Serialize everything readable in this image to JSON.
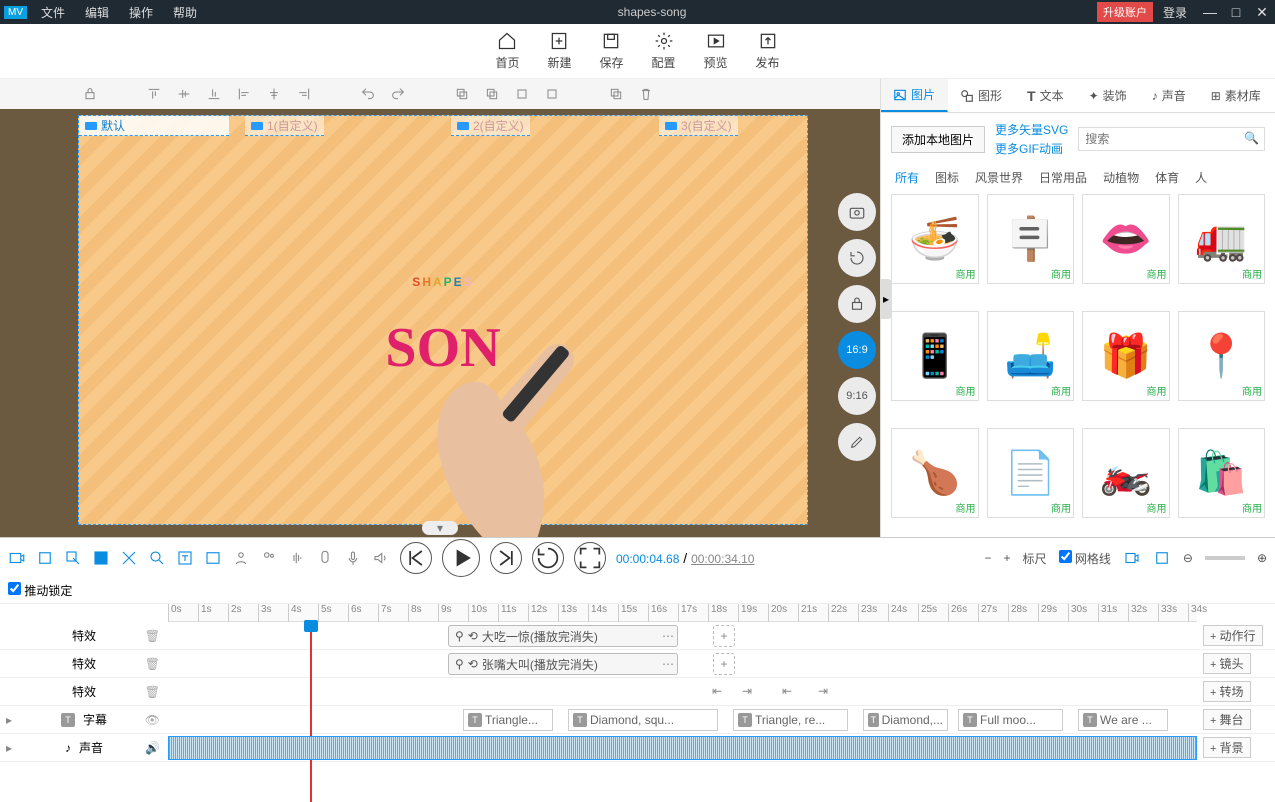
{
  "titlebar": {
    "menus": [
      "文件",
      "编辑",
      "操作",
      "帮助"
    ],
    "title": "shapes-song",
    "upgrade": "升级账户",
    "login": "登录"
  },
  "toolbar": [
    {
      "id": "home",
      "label": "首页"
    },
    {
      "id": "new",
      "label": "新建"
    },
    {
      "id": "save",
      "label": "保存"
    },
    {
      "id": "config",
      "label": "配置"
    },
    {
      "id": "preview",
      "label": "预览"
    },
    {
      "id": "publish",
      "label": "发布"
    }
  ],
  "canvas": {
    "cameras": [
      {
        "label": "默认",
        "active": true
      },
      {
        "label": "1(自定义)"
      },
      {
        "label": "2(自定义)"
      },
      {
        "label": "3(自定义)"
      }
    ],
    "ratios": [
      "16:9",
      "9:16"
    ],
    "text1": "SHAPES",
    "text2": "SON"
  },
  "assets": {
    "tabs": [
      {
        "id": "image",
        "label": "图片",
        "active": true
      },
      {
        "id": "shape",
        "label": "图形"
      },
      {
        "id": "text",
        "label": "文本"
      },
      {
        "id": "decor",
        "label": "装饰"
      },
      {
        "id": "sound",
        "label": "声音"
      },
      {
        "id": "lib",
        "label": "素材库"
      }
    ],
    "addLocal": "添加本地图片",
    "moreSvg": "更多矢量SVG",
    "moreGif": "更多GIF动画",
    "searchPlaceholder": "搜索",
    "filters": [
      "所有",
      "图标",
      "风景世界",
      "日常用品",
      "动植物",
      "体育",
      "人"
    ],
    "items": [
      {
        "n": "noodles"
      },
      {
        "n": "signboard"
      },
      {
        "n": "lips"
      },
      {
        "n": "truck"
      },
      {
        "n": "phone"
      },
      {
        "n": "sofa"
      },
      {
        "n": "gift"
      },
      {
        "n": "map-pin"
      },
      {
        "n": "chicken"
      },
      {
        "n": "papers"
      },
      {
        "n": "motorbike"
      },
      {
        "n": "bag"
      }
    ],
    "tag": "商用"
  },
  "playbar": {
    "cur": "00:00:04.68",
    "tot": "00:00:34.10",
    "marker": "标尺",
    "grid": "网格线"
  },
  "lock": "推动锁定",
  "ruler": {
    "start": 0,
    "end": 34
  },
  "tracks": {
    "fx": "特效",
    "subtitle": "字幕",
    "audio": "声音",
    "addBtns": [
      "动作行",
      "镜头",
      "转场",
      "舞台",
      "背景"
    ],
    "fxClips": [
      {
        "label": "大吃一惊(播放完消失)"
      },
      {
        "label": "张嘴大叫(播放完消失)"
      }
    ],
    "subs": [
      "Triangle...",
      "Diamond, squ...",
      "Triangle, re...",
      "Diamond,...",
      "Full moo...",
      "We are ..."
    ]
  }
}
